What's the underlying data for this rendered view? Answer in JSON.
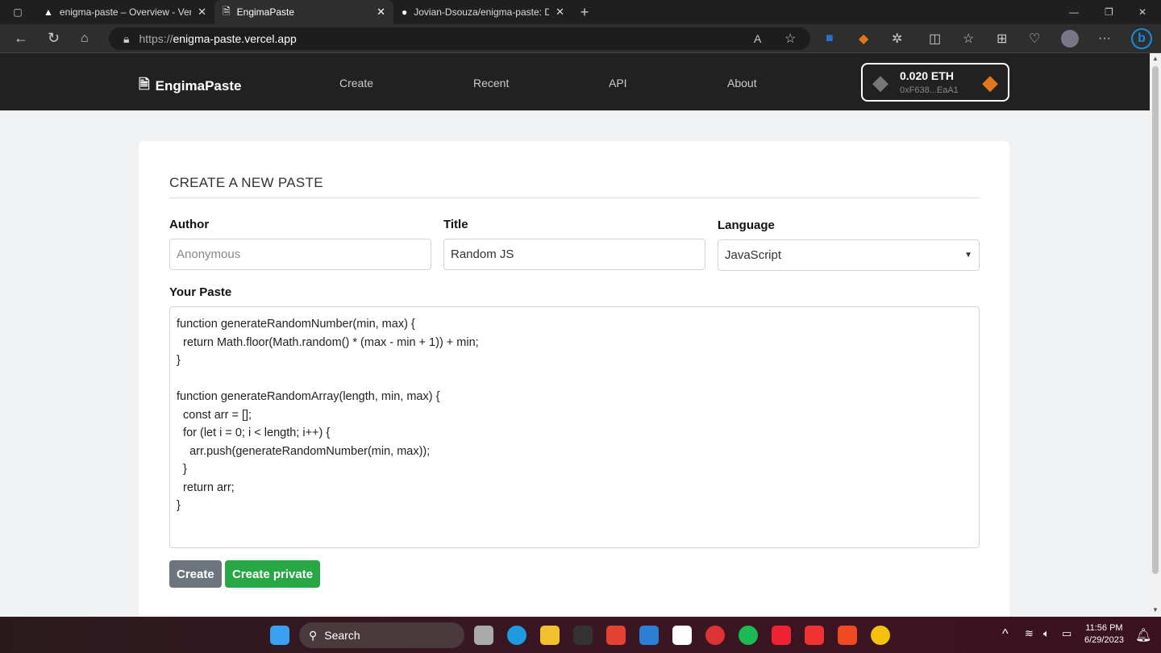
{
  "browser": {
    "tabs": [
      {
        "title": "enigma-paste – Overview - Vercel",
        "icon": "vercel-icon",
        "active": false
      },
      {
        "title": "EngimaPaste",
        "icon": "document-icon",
        "active": true
      },
      {
        "title": "Jovian-Dsouza/enigma-paste: De",
        "icon": "github-icon",
        "active": false
      }
    ],
    "url_protocol": "https://",
    "url_host": "enigma-paste.vercel.app"
  },
  "navbar": {
    "brand": "EngimaPaste",
    "links": [
      "Create",
      "Recent",
      "API",
      "About"
    ],
    "wallet": {
      "balance": "0.020 ETH",
      "account": "0xF638...EaA1"
    }
  },
  "form": {
    "heading": "CREATE A NEW PASTE",
    "author_label": "Author",
    "author_placeholder": "Anonymous",
    "author_value": "",
    "title_label": "Title",
    "title_value": "Random JS",
    "language_label": "Language",
    "language_value": "JavaScript",
    "paste_label": "Your Paste",
    "paste_value": "function generateRandomNumber(min, max) {\n  return Math.floor(Math.random() * (max - min + 1)) + min;\n}\n\nfunction generateRandomArray(length, min, max) {\n  const arr = [];\n  for (let i = 0; i < length; i++) {\n    arr.push(generateRandomNumber(min, max));\n  }\n  return arr;\n}",
    "create_label": "Create",
    "create_private_label": "Create private",
    "colors": {
      "create": "#6c757d",
      "create_private": "#28a745"
    }
  },
  "taskbar": {
    "search_label": "Search",
    "time": "11:56 PM",
    "date": "6/29/2023"
  }
}
